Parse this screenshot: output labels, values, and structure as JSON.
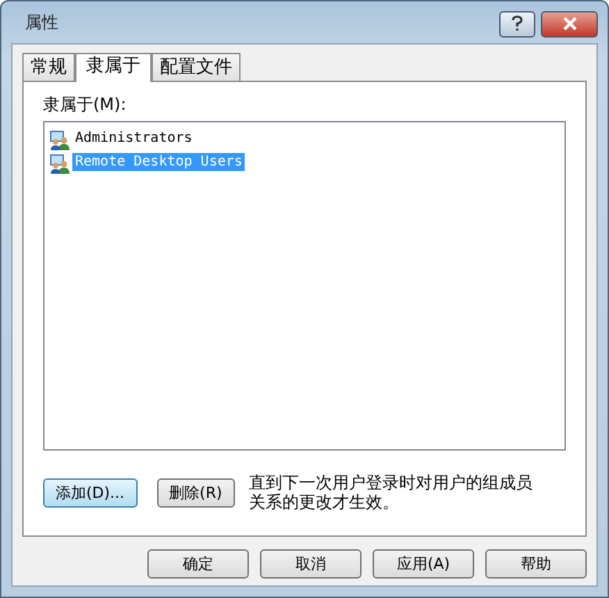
{
  "window": {
    "title": "属性"
  },
  "tabs": [
    {
      "label": "常规",
      "selected": false
    },
    {
      "label": "隶属于",
      "selected": true
    },
    {
      "label": "配置文件",
      "selected": false
    }
  ],
  "member_of": {
    "label": "隶属于(M):",
    "items": [
      {
        "name": "Administrators",
        "selected": false
      },
      {
        "name": "Remote Desktop Users",
        "selected": true
      }
    ]
  },
  "actions": [
    {
      "label": "添加(D)...",
      "focused": true
    },
    {
      "label": "删除(R)",
      "focused": false
    }
  ],
  "note": "直到下一次用户登录时对用户的组成员关系的更改才生效。",
  "buttons": [
    "确定",
    "取消",
    "应用(A)",
    "帮助"
  ]
}
